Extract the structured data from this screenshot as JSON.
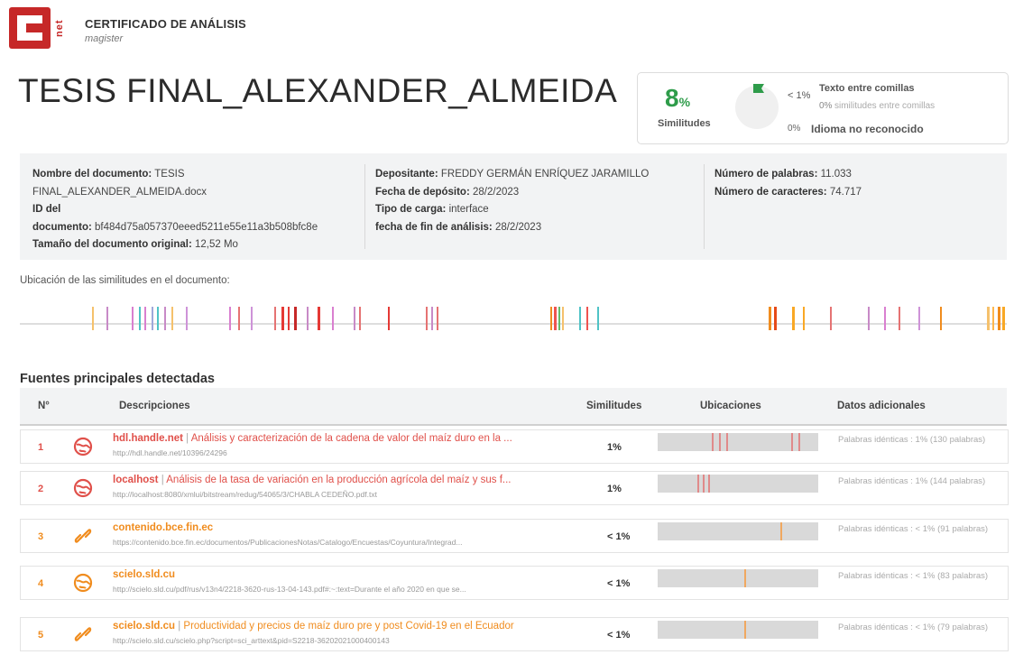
{
  "header": {
    "logo_text": "net",
    "title": "CERTIFICADO DE ANÁLISIS",
    "subtitle": "magister"
  },
  "document_title": "TESIS FINAL_ALEXANDER_ALMEIDA",
  "stats": {
    "similarity_value": "8",
    "similarity_unit": "%",
    "similarity_label": "Similitudes",
    "quoted_pct": "< 1%",
    "quoted_label": "Texto entre comillas",
    "quoted_sim_pct": "0%",
    "quoted_sim_label": "similitudes entre comillas",
    "unrecognized_pct": "0%",
    "unrecognized_label": "Idioma no reconocido",
    "accent_color": "#2e9c4a"
  },
  "info": {
    "col1": {
      "name_label": "Nombre del documento:",
      "name_value_1": "TESIS",
      "name_value_2": "FINAL_ALEXANDER_ALMEIDA.docx",
      "id_label_1": "ID del",
      "id_label_2": "documento:",
      "id_value": "bf484d75a057370eeed5211e55e11a3b508bfc8e",
      "size_label": "Tamaño del documento original:",
      "size_value": "12,52 Mo"
    },
    "col2": {
      "depositor_label": "Depositante:",
      "depositor_value": "FREDDY GERMÁN ENRÍQUEZ JARAMILLO",
      "deposit_date_label": "Fecha de depósito:",
      "deposit_date_value": "28/2/2023",
      "upload_type_label": "Tipo de carga:",
      "upload_type_value": "interface",
      "end_date_label": "fecha de fin de análisis:",
      "end_date_value": "28/2/2023"
    },
    "col3": {
      "words_label": "Número de palabras:",
      "words_value": "11.033",
      "chars_label": "Número de caracteres:",
      "chars_value": "74.717"
    }
  },
  "locations": {
    "label": "Ubicación de las similitudes en el documento:"
  },
  "sources": {
    "title": "Fuentes principales detectadas",
    "headers": {
      "num": "N°",
      "desc": "Descripciones",
      "sim": "Similitudes",
      "loc": "Ubicaciones",
      "extra": "Datos adicionales"
    },
    "rows": [
      {
        "num": "1",
        "icon": "globe-icon",
        "color": "#e0504a",
        "site": "hdl.handle.net",
        "desc": "Análisis y caracterización de la cadena de valor del maíz duro en la ...",
        "url": "http://hdl.handle.net/10396/24296",
        "sim": "1%",
        "extra": "Palabras idénticas : 1% (130 palabras)"
      },
      {
        "num": "2",
        "icon": "globe-icon",
        "color": "#e0504a",
        "site": "localhost",
        "desc": "Análisis de la tasa de variación en la producción agrícola del maíz y sus f...",
        "url": "http://localhost:8080/xmlui/bitstream/redug/54065/3/CHABLA CEDEÑO.pdf.txt",
        "sim": "1%",
        "extra": "Palabras idénticas : 1% (144 palabras)"
      },
      {
        "num": "3",
        "icon": "link-icon",
        "color": "#f08c1e",
        "site": "contenido.bce.fin.ec",
        "desc": "",
        "url": "https://contenido.bce.fin.ec/documentos/PublicacionesNotas/Catalogo/Encuestas/Coyuntura/Integrad...",
        "sim": "< 1%",
        "extra": "Palabras idénticas : < 1% (91 palabras)"
      },
      {
        "num": "4",
        "icon": "globe-icon",
        "color": "#f08c1e",
        "site": "scielo.sld.cu",
        "desc": "",
        "url": "http://scielo.sld.cu/pdf/rus/v13n4/2218-3620-rus-13-04-143.pdf#:~:text=Durante el año 2020 en que se...",
        "sim": "< 1%",
        "extra": "Palabras idénticas : < 1% (83 palabras)"
      },
      {
        "num": "5",
        "icon": "link-icon",
        "color": "#f08c1e",
        "site": "scielo.sld.cu",
        "desc": "Productividad y precios de maíz duro pre y post Covid-19 en el Ecuador",
        "url": "http://scielo.sld.cu/scielo.php?script=sci_arttext&pid=S2218-36202021000400143",
        "sim": "< 1%",
        "extra": "Palabras idénticas : < 1% (79 palabras)"
      }
    ]
  }
}
